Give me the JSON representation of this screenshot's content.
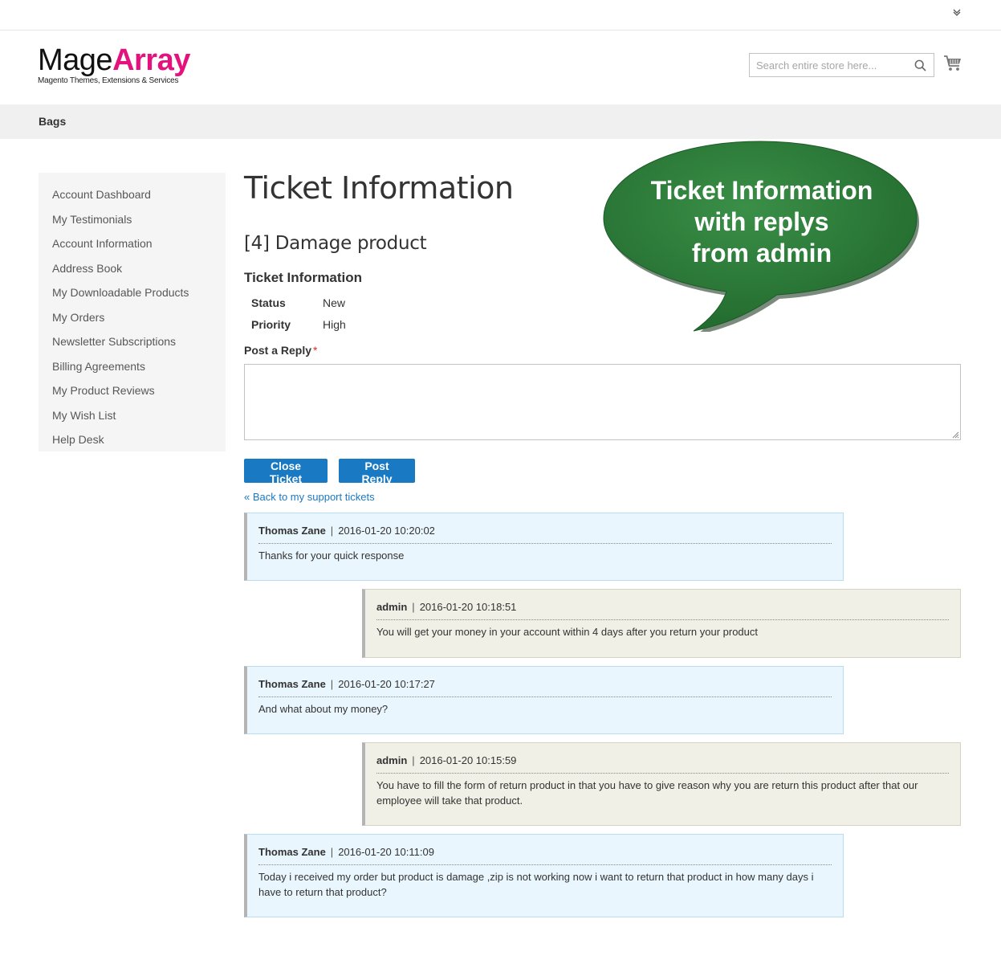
{
  "header": {
    "logo": {
      "main_start": "Mage",
      "main_accent": "Array",
      "tagline": "Magento Themes, Extensions & Services"
    },
    "search": {
      "placeholder": "Search entire store here..."
    },
    "icons": [
      "chevron-down-icon",
      "search-icon",
      "cart-icon"
    ]
  },
  "nav": {
    "items": [
      {
        "label": "Bags"
      }
    ]
  },
  "sidebar": {
    "items": [
      {
        "label": "Account Dashboard"
      },
      {
        "label": "My Testimonials"
      },
      {
        "label": "Account Information"
      },
      {
        "label": "Address Book"
      },
      {
        "label": "My Downloadable Products"
      },
      {
        "label": "My Orders"
      },
      {
        "label": "Newsletter Subscriptions"
      },
      {
        "label": "Billing Agreements"
      },
      {
        "label": "My Product Reviews"
      },
      {
        "label": "My Wish List"
      },
      {
        "label": "Help Desk"
      }
    ]
  },
  "main": {
    "page_title": "Ticket Information",
    "ticket_subject": "[4] Damage product",
    "section_title": "Ticket Information",
    "info": [
      {
        "key": "Status",
        "value": "New"
      },
      {
        "key": "Priority",
        "value": "High"
      }
    ],
    "reply_label": "Post a Reply",
    "required_mark": "*",
    "reply_value": "",
    "buttons": {
      "close": "Close Ticket",
      "post": "Post Reply"
    },
    "back_link": "« Back to my support tickets"
  },
  "messages": [
    {
      "role": "user",
      "author": "Thomas Zane",
      "separator": "|",
      "time": "2016-01-20 10:20:02",
      "text": "Thanks for your quick response"
    },
    {
      "role": "admin",
      "author": "admin",
      "separator": "|",
      "time": "2016-01-20 10:18:51",
      "text": "You will get your money in your account within 4 days after you return your product"
    },
    {
      "role": "user",
      "author": "Thomas Zane",
      "separator": "|",
      "time": "2016-01-20 10:17:27",
      "text": "And what about my money?"
    },
    {
      "role": "admin",
      "author": "admin",
      "separator": "|",
      "time": "2016-01-20 10:15:59",
      "text": "You have to fill the form of return product in that you have to give reason why you are return this product after that our employee will take that product."
    },
    {
      "role": "user",
      "author": "Thomas Zane",
      "separator": "|",
      "time": "2016-01-20 10:11:09",
      "text": "Today i received my order but product is damage ,zip is not working now i want to return that product in how many days i have to return that product?"
    }
  ],
  "callout": {
    "lines": [
      "Ticket Information",
      "with replys",
      "from admin"
    ],
    "color": "#2e7d3a"
  },
  "colors": {
    "brand_accent": "#e4127d",
    "primary_button": "#1979c3",
    "link": "#1979c3"
  }
}
